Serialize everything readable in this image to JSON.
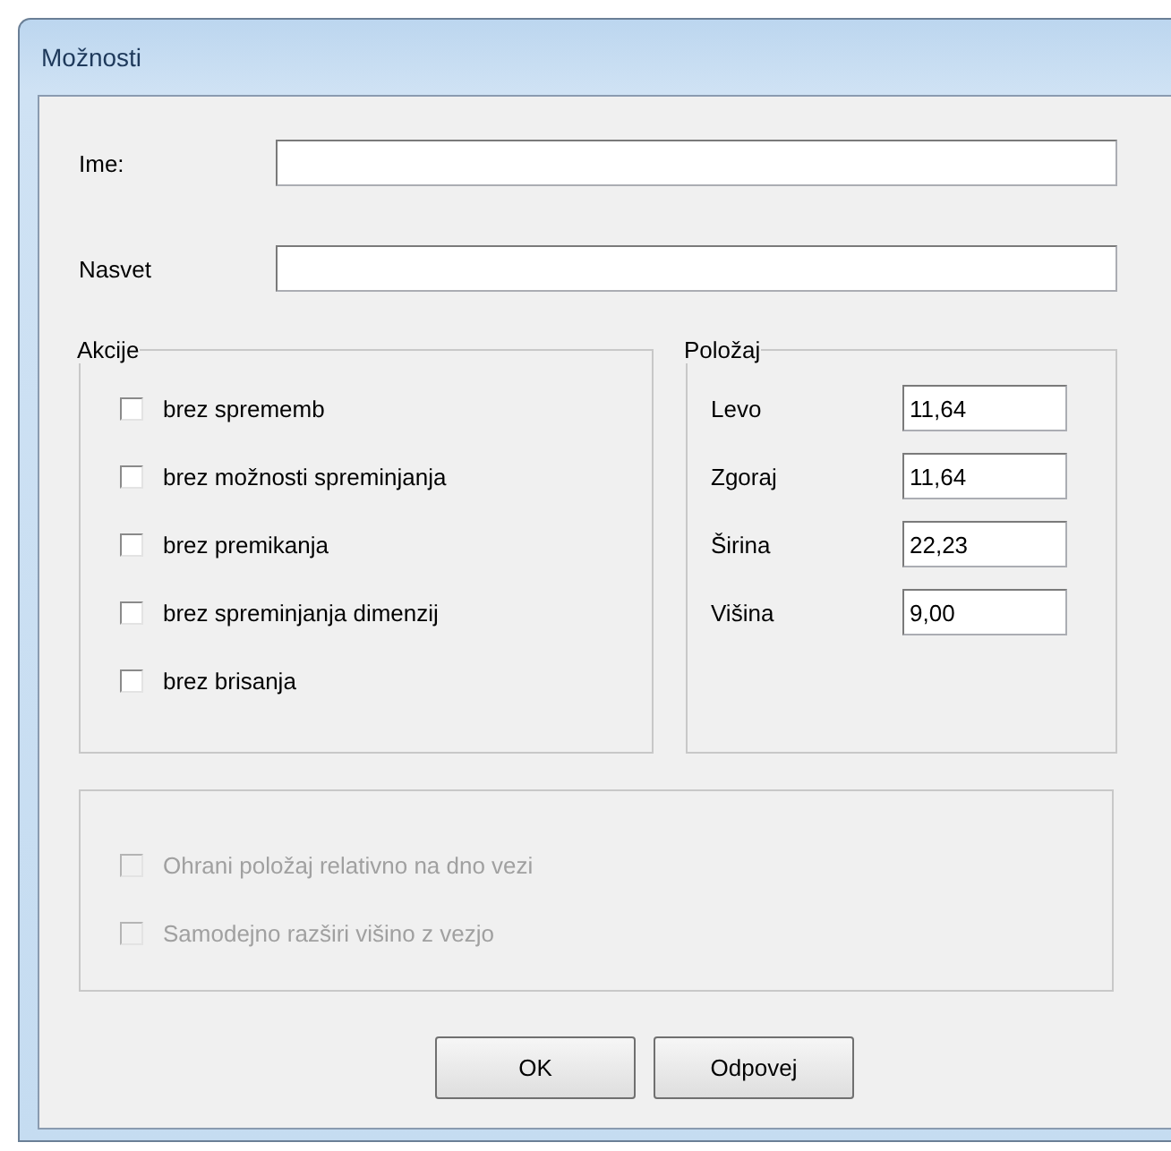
{
  "window": {
    "title": "Možnosti"
  },
  "fields": [
    {
      "label": "Ime:"
    },
    {
      "label": "Nasvet"
    }
  ],
  "actions": {
    "title": "Akcije",
    "items": [
      {
        "label": "brez sprememb",
        "checked": false,
        "disabled": false
      },
      {
        "label": "brez možnosti spreminjanja",
        "checked": false,
        "disabled": false
      },
      {
        "label": "brez premikanja",
        "checked": false,
        "disabled": false
      },
      {
        "label": "brez spreminjanja dimenzij",
        "checked": false,
        "disabled": false
      },
      {
        "label": "brez brisanja",
        "checked": false,
        "disabled": false
      }
    ]
  },
  "position": {
    "title": "Položaj",
    "items": [
      {
        "label": "Levo",
        "value": "11,64"
      },
      {
        "label": "Zgoraj",
        "value": "11,64"
      },
      {
        "label": "Širina",
        "value": "22,23"
      },
      {
        "label": "Višina",
        "value": "9,00"
      }
    ]
  },
  "options": [
    {
      "label": "Ohrani položaj relativno na dno vezi",
      "checked": false,
      "disabled": true
    },
    {
      "label": "Samodejno razširi višino z vezjo",
      "checked": false,
      "disabled": true
    }
  ],
  "buttons": [
    "OK",
    "Odpovej"
  ]
}
